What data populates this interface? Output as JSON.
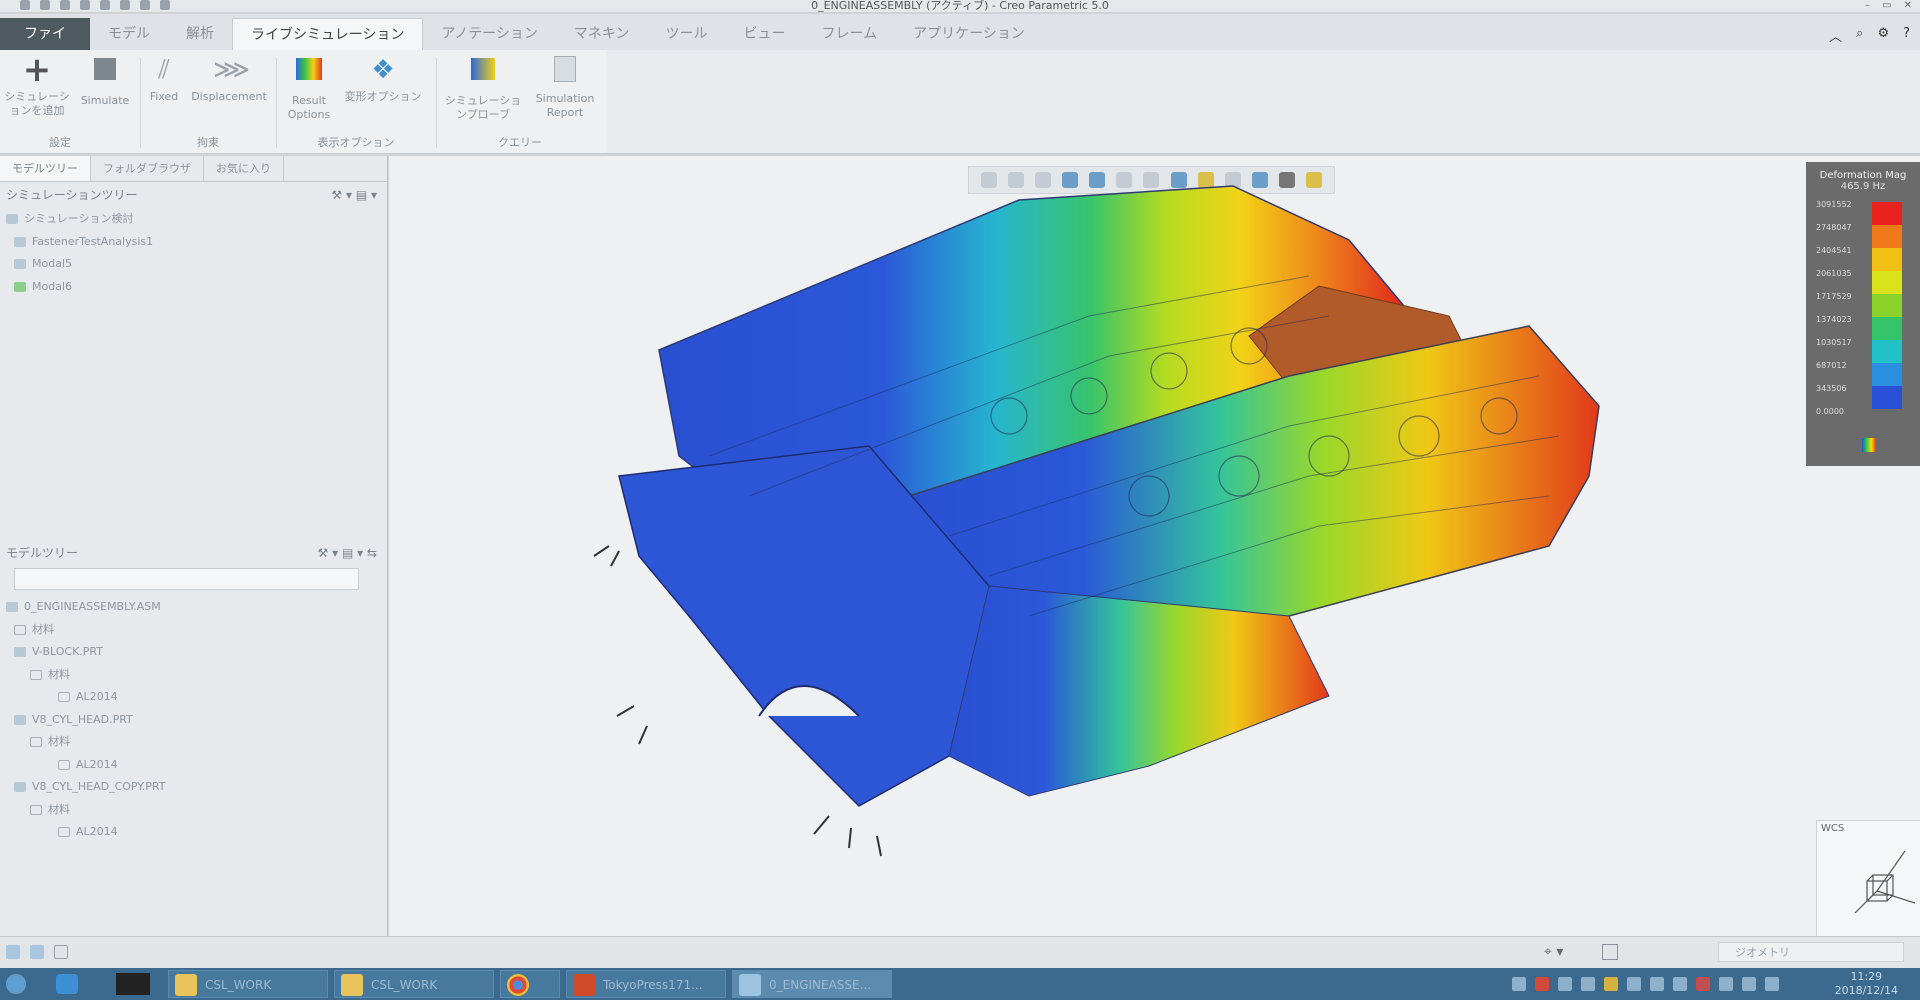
{
  "window": {
    "title": "0_ENGINEASSEMBLY (アクティブ) - Creo Parametric 5.0"
  },
  "menu": {
    "tabs": [
      "ファイル",
      "モデル",
      "解析",
      "ライブシミュレーション",
      "アノテーション",
      "マネキン",
      "ツール",
      "ビュー",
      "フレーム",
      "アプリケーション"
    ]
  },
  "ribbon": {
    "buttons": {
      "add_sim": "シミュレーションを追加",
      "simulate": "Simulate",
      "fixed": "Fixed",
      "displacement": "Displacement",
      "result_options": "Result Options",
      "deform_options": "変形オプション",
      "sim_probe": "シミュレーションプローブ",
      "sim_report": "Simulation Report"
    },
    "groups": {
      "settings": "設定",
      "constraint": "拘束",
      "display_options": "表示オプション",
      "query": "クエリー"
    }
  },
  "left_panel": {
    "tabs": [
      "モデルツリー",
      "フォルダブラウザ",
      "お気に入り"
    ],
    "sim_tree": {
      "header": "シミュレーションツリー",
      "items": [
        "シミュレーション検討",
        "FastenerTestAnalysis1",
        "Modal5",
        "Modal6"
      ]
    },
    "model_tree": {
      "header": "モデルツリー",
      "items": [
        "0_ENGINEASSEMBLY.ASM",
        "材料",
        "V-BLOCK.PRT",
        "材料",
        "AL2014",
        "V8_CYL_HEAD.PRT",
        "材料",
        "AL2014",
        "V8_CYL_HEAD_COPY.PRT",
        "材料",
        "AL2014"
      ]
    }
  },
  "legend": {
    "title": "Deformation Mag",
    "subtitle": "465.9 Hz",
    "values": [
      "3091552",
      "2748047",
      "2404541",
      "2061035",
      "1717529",
      "1374023",
      "1030517",
      "687012",
      "343506",
      "0.0000"
    ],
    "colors": [
      "#e8231d",
      "#f07a1a",
      "#f2c014",
      "#d9e21a",
      "#8bd22a",
      "#36c46a",
      "#22c0c8",
      "#2a8fe0",
      "#2a52d8"
    ]
  },
  "triad": {
    "label": "WCS"
  },
  "statusbar": {
    "selection_filter": "ジオメトリ"
  },
  "taskbar": {
    "items": [
      "CSL_WORK",
      "CSL_WORK",
      "",
      "TokyoPress171...",
      "0_ENGINEASSE..."
    ],
    "time": "11:29",
    "date": "2018/12/14"
  }
}
